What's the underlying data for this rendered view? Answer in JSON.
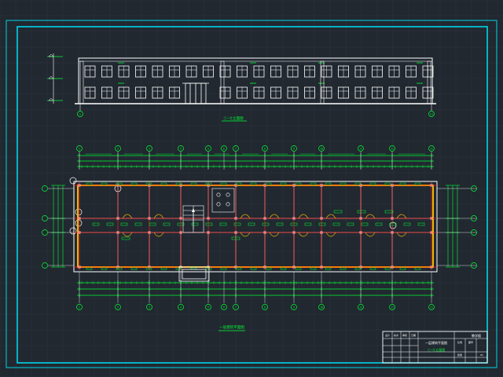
{
  "drawing": {
    "elevation_title": "①—⑪立面图",
    "plan_title": "一层建筑平面图",
    "plan_axis_marks": [
      "1",
      "2",
      "3",
      "4",
      "5",
      "6",
      "7",
      "8",
      "9",
      "10",
      "11"
    ],
    "elevation_end_marks": [
      "1",
      "11"
    ],
    "title_block": {
      "sheet_name": "一层建筑平面图",
      "sub_name": "①—⑪立面图",
      "project": "教学楼",
      "cells": [
        "设计",
        "校对",
        "审核",
        "日期",
        "比例",
        "图号",
        "建施",
        "01"
      ]
    }
  },
  "colors": {
    "background": "#212830",
    "frame": "#00d4e8",
    "axis_red": "#ff2020",
    "dimension_green": "#00ff33",
    "wall_yellow": "#f0b400",
    "line_white": "#ffffff"
  }
}
